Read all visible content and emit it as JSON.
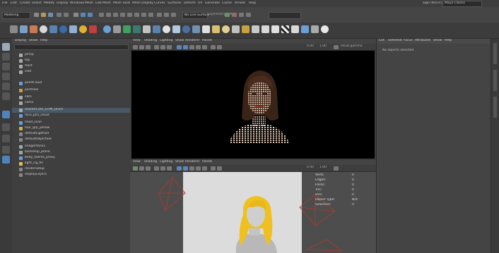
{
  "menubar": {
    "items": [
      "File",
      "Edit",
      "Create",
      "Select",
      "Modify",
      "Display",
      "Windows",
      "Mesh",
      "Edit Mesh",
      "Mesh Tools",
      "Mesh Display",
      "Curves",
      "Surfaces",
      "Deform",
      "UV",
      "Generate",
      "Cache",
      "Arnold",
      "Help"
    ],
    "user": "Sign In",
    "workspace_label": "Workspace:",
    "workspace_value": "Maya Classic"
  },
  "statusline": {
    "mode_select": "Modeling",
    "live_surface": "No Live Surface",
    "symmetry": "Symmetry: Off",
    "render_field": ""
  },
  "outliner": {
    "menu": [
      "Display",
      "Show",
      "Help"
    ],
    "search_placeholder": "",
    "items": [
      {
        "label": "persp",
        "icon": "camera"
      },
      {
        "label": "top",
        "icon": "camera"
      },
      {
        "label": "front",
        "icon": "camera"
      },
      {
        "label": "side",
        "icon": "camera"
      },
      {
        "label": "pointCloud",
        "icon": "mesh"
      },
      {
        "label": "particles",
        "icon": "particle"
      },
      {
        "label": "cam",
        "icon": "camera"
      },
      {
        "label": "cam2",
        "icon": "camera"
      },
      {
        "label": "masterCam_STIM_LIGHT",
        "icon": "camera"
      },
      {
        "label": "face_ptcl_cloud",
        "icon": "mesh"
      },
      {
        "label": "head_scan",
        "icon": "mesh"
      },
      {
        "label": "hair_grp_yellow",
        "icon": "hair"
      },
      {
        "label": "defaultLightSet",
        "icon": "set"
      },
      {
        "label": "defaultObjectSet",
        "icon": "set"
      },
      {
        "label": "imagePlane1",
        "icon": "plane"
      },
      {
        "label": "backdrop_plane",
        "icon": "plane"
      },
      {
        "label": "body_lowres_proxy",
        "icon": "mesh"
      },
      {
        "label": "light_rig_fill",
        "icon": "light"
      },
      {
        "label": "renderSetup",
        "icon": "set"
      },
      {
        "label": "displayLayer1",
        "icon": "set"
      }
    ]
  },
  "viewport_top": {
    "menu": [
      "View",
      "Shading",
      "Lighting",
      "Show",
      "Renderer",
      "Panels"
    ],
    "gamma": "0.00",
    "exposure": "1.00",
    "colorspace": "sRGB gamma"
  },
  "viewport_bottom": {
    "menu": [
      "View",
      "Shading",
      "Lighting",
      "Show",
      "Renderer",
      "Panels"
    ],
    "gamma": "0.00",
    "exposure": "1.00",
    "hud": [
      {
        "label": "Verts:",
        "value": "0"
      },
      {
        "label": "Edges:",
        "value": "0"
      },
      {
        "label": "Faces:",
        "value": "0"
      },
      {
        "label": "Tris:",
        "value": "0"
      },
      {
        "label": "UVs:",
        "value": "0"
      },
      {
        "label": "Object Type:",
        "value": "N/A"
      },
      {
        "label": "Selection:",
        "value": "0"
      }
    ]
  },
  "rightpanel": {
    "tabs": [
      "List",
      "Selected",
      "Focus",
      "Attributes",
      "Show",
      "Help"
    ],
    "info": "No objects selected"
  },
  "colors": {
    "hair": "#f0c020",
    "camera_lines": "#b03a2a",
    "accent": "#6aa0d8",
    "skin": "#c8a890"
  }
}
